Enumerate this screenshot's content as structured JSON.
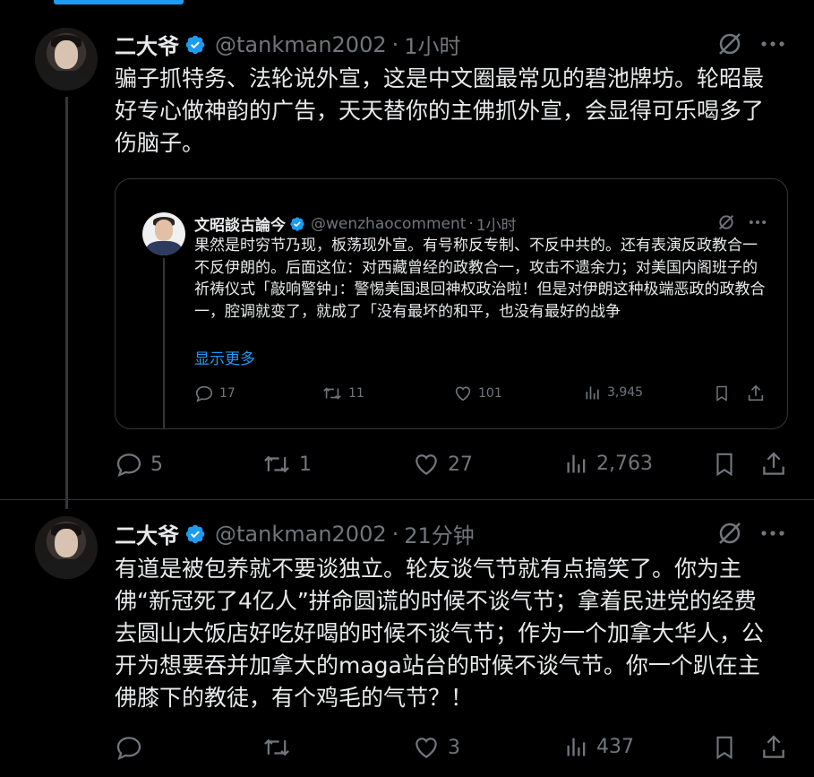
{
  "tweet1": {
    "name": "二大爷",
    "handle": "@tankman2002",
    "sep": "·",
    "time": "1小时",
    "text": "骗子抓特务、法轮说外宣，这是中文圈最常见的碧池牌坊。轮昭最好专心做神韵的广告，天天替你的主佛抓外宣，会显得可乐喝多了伤脑子。",
    "reply_count": "5",
    "retweet_count": "1",
    "like_count": "27",
    "view_count": "2,763"
  },
  "quote": {
    "name": "文昭談古論今",
    "handle": "@wenzhaocomment",
    "sep": "·",
    "time": "1小时",
    "text": "果然是时穷节乃现，板荡现外宣。有号称反专制、不反中共的。还有表演反政教合一不反伊朗的。后面这位：对西藏曾经的政教合一，攻击不遗余力；对美国内阁班子的祈祷仪式「敲响警钟」：警惕美国退回神权政治啦！但是对伊朗这种极端恶政的政教合一，腔调就变了，就成了「没有最坏的和平，也没有最好的战争",
    "show_more": "显示更多",
    "reply_count": "17",
    "retweet_count": "11",
    "like_count": "101",
    "view_count": "3,945"
  },
  "tweet2": {
    "name": "二大爷",
    "handle": "@tankman2002",
    "sep": "·",
    "time": "21分钟",
    "text": "有道是被包养就不要谈独立。轮友谈气节就有点搞笑了。你为主佛“新冠死了4亿人”拼命圆谎的时候不谈气节；拿着民进党的经费去圆山大饭店好吃好喝的时候不谈气节；作为一个加拿大华人，公开为想要吞并加拿大的maga站台的时候不谈气节。你一个趴在主佛膝下的教徒，有个鸡毛的气节？！",
    "like_count": "3",
    "view_count": "437"
  },
  "colors": {
    "background": "#000000",
    "text": "#e7e9ea",
    "muted": "#71767b",
    "accent": "#1d9bf0",
    "border": "#333639"
  },
  "icons": [
    "verified-badge-icon",
    "grok-icon",
    "more-icon",
    "reply-icon",
    "retweet-icon",
    "like-icon",
    "views-icon",
    "bookmark-icon",
    "share-icon"
  ]
}
